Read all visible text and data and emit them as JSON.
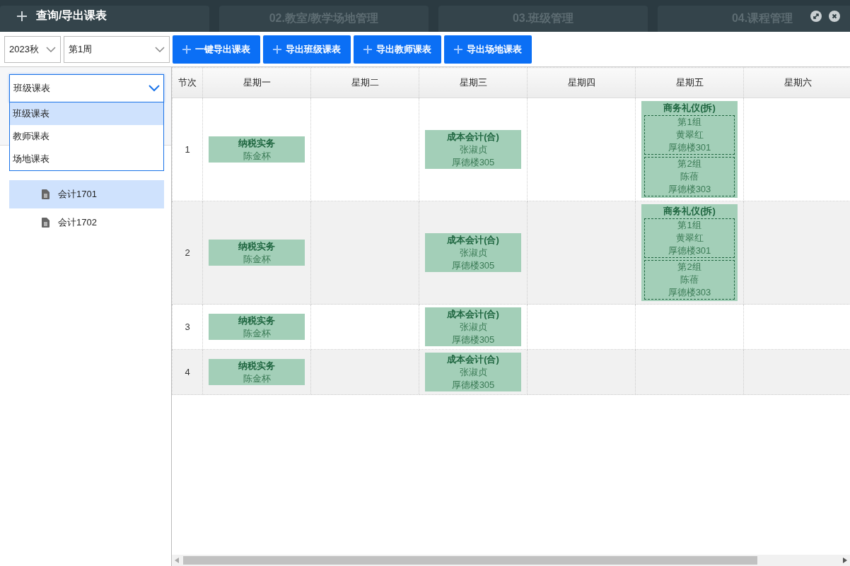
{
  "window": {
    "title": "查询/导出课表"
  },
  "background_tabs": [
    "02.教室/教学场地管理",
    "03.班级管理",
    "04.课程管理"
  ],
  "toolbar": {
    "term": "2023秋",
    "week": "第1周",
    "buttons": [
      "一键导出课表",
      "导出班级课表",
      "导出教师课表",
      "导出场地课表"
    ]
  },
  "sidebar": {
    "dropdown": {
      "value": "班级课表",
      "expanded": true,
      "options": [
        {
          "label": "班级课表",
          "selected": true
        },
        {
          "label": "教师课表",
          "selected": false
        },
        {
          "label": "场地课表",
          "selected": false
        }
      ]
    },
    "items": [
      {
        "label": "会计1701",
        "selected": true
      },
      {
        "label": "会计1702",
        "selected": false
      }
    ]
  },
  "table": {
    "columns": [
      "节次",
      "星期一",
      "星期二",
      "星期三",
      "星期四",
      "星期五",
      "星期六"
    ],
    "rows": [
      {
        "period": "1",
        "cells": [
          {
            "name": "纳税实务",
            "teacher": "陈金杯"
          },
          null,
          {
            "name": "成本会计(合)",
            "teacher": "张淑贞",
            "room": "厚德楼305"
          },
          null,
          {
            "name": "商务礼仪(拆)",
            "groups": [
              {
                "group": "第1组",
                "teacher": "黄翠红",
                "room": "厚德楼301"
              },
              {
                "group": "第2组",
                "teacher": "陈蓓",
                "room": "厚德楼303"
              }
            ]
          },
          null
        ]
      },
      {
        "period": "2",
        "cells": [
          {
            "name": "纳税实务",
            "teacher": "陈金杯"
          },
          null,
          {
            "name": "成本会计(合)",
            "teacher": "张淑贞",
            "room": "厚德楼305"
          },
          null,
          {
            "name": "商务礼仪(拆)",
            "groups": [
              {
                "group": "第1组",
                "teacher": "黄翠红",
                "room": "厚德楼301"
              },
              {
                "group": "第2组",
                "teacher": "陈蓓",
                "room": "厚德楼303"
              }
            ]
          },
          null
        ]
      },
      {
        "period": "3",
        "cells": [
          {
            "name": "纳税实务",
            "teacher": "陈金杯"
          },
          null,
          {
            "name": "成本会计(合)",
            "teacher": "张淑贞",
            "room": "厚德楼305"
          },
          null,
          null,
          null
        ]
      },
      {
        "period": "4",
        "cells": [
          {
            "name": "纳税实务",
            "teacher": "陈金杯"
          },
          null,
          {
            "name": "成本会计(合)",
            "teacher": "张淑贞",
            "room": "厚德楼305"
          },
          null,
          null,
          null
        ]
      }
    ]
  }
}
